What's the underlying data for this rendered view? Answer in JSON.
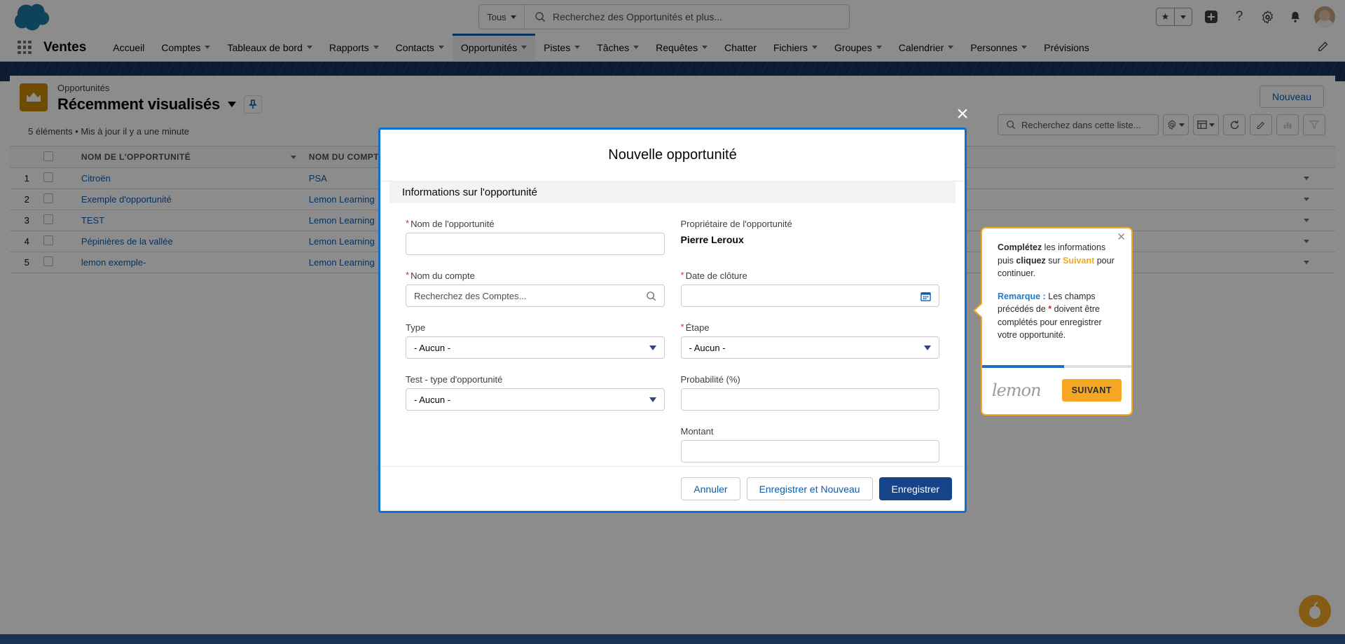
{
  "header": {
    "logo": "salesforce-cloud-logo",
    "search": {
      "scope": "Tous",
      "placeholder": "Recherchez des Opportunités et plus...",
      "value": ""
    },
    "icons": [
      "favorites-star",
      "favorites-caret",
      "quick-add",
      "help",
      "setup-gear",
      "notifications",
      "user-avatar"
    ]
  },
  "nav": {
    "app_name": "Ventes",
    "items": [
      {
        "label": "Accueil",
        "has_menu": false,
        "active": false
      },
      {
        "label": "Comptes",
        "has_menu": true,
        "active": false
      },
      {
        "label": "Tableaux de bord",
        "has_menu": true,
        "active": false
      },
      {
        "label": "Rapports",
        "has_menu": true,
        "active": false
      },
      {
        "label": "Contacts",
        "has_menu": true,
        "active": false
      },
      {
        "label": "Opportunités",
        "has_menu": true,
        "active": true
      },
      {
        "label": "Pistes",
        "has_menu": true,
        "active": false
      },
      {
        "label": "Tâches",
        "has_menu": true,
        "active": false
      },
      {
        "label": "Requêtes",
        "has_menu": true,
        "active": false
      },
      {
        "label": "Chatter",
        "has_menu": false,
        "active": false
      },
      {
        "label": "Fichiers",
        "has_menu": true,
        "active": false
      },
      {
        "label": "Groupes",
        "has_menu": true,
        "active": false
      },
      {
        "label": "Calendrier",
        "has_menu": true,
        "active": false
      },
      {
        "label": "Personnes",
        "has_menu": true,
        "active": false
      },
      {
        "label": "Prévisions",
        "has_menu": false,
        "active": false
      }
    ]
  },
  "listview": {
    "eyebrow": "Opportunités",
    "title": "Récemment visualisés",
    "subtitle": "5 éléments • Mis à jour il y a une minute",
    "new_button": "Nouveau",
    "search_placeholder": "Recherchez dans cette liste...",
    "columns": [
      "NOM DE L'OPPORTUNITÉ",
      "NOM DU COMPTE"
    ],
    "rows": [
      {
        "n": "1",
        "name": "Citroën",
        "account": "PSA"
      },
      {
        "n": "2",
        "name": "Exemple d'opportunité",
        "account": "Lemon Learning"
      },
      {
        "n": "3",
        "name": "TEST",
        "account": "Lemon Learning"
      },
      {
        "n": "4",
        "name": "Pépinières de la vallée",
        "account": "Lemon Learning"
      },
      {
        "n": "5",
        "name": "lemon exemple-",
        "account": "Lemon Learning"
      }
    ]
  },
  "modal": {
    "title": "Nouvelle opportunité",
    "section": "Informations sur l'opportunité",
    "fields": {
      "opportunity_name": {
        "label": "Nom de l'opportunité",
        "required": true,
        "value": "",
        "placeholder": ""
      },
      "owner": {
        "label": "Propriétaire de l'opportunité",
        "required": false,
        "value": "Pierre Leroux"
      },
      "account_name": {
        "label": "Nom du compte",
        "required": true,
        "placeholder": "Recherchez des Comptes...",
        "value": ""
      },
      "close_date": {
        "label": "Date de clôture",
        "required": true,
        "value": ""
      },
      "type": {
        "label": "Type",
        "required": false,
        "value": "- Aucun -"
      },
      "stage": {
        "label": "Étape",
        "required": true,
        "value": "- Aucun -"
      },
      "test_type": {
        "label": "Test - type d'opportunité",
        "required": false,
        "value": "- Aucun -"
      },
      "probability": {
        "label": "Probabilité (%)",
        "required": false,
        "value": ""
      },
      "amount": {
        "label": "Montant",
        "required": false,
        "value": ""
      }
    },
    "buttons": {
      "cancel": "Annuler",
      "save_new": "Enregistrer et Nouveau",
      "save": "Enregistrer"
    }
  },
  "coach": {
    "line1_a": "Complétez",
    "line1_b": " les informations puis ",
    "line1_c": "cliquez",
    "line1_d": " sur ",
    "line1_e": "Suivant",
    "line1_f": " pour continuer.",
    "note_label": "Remarque :",
    "note_a": " Les champs précédés de ",
    "note_star": "*",
    "note_b": " doivent être complétés pour enregistrer votre opportunité.",
    "brand": "lemon",
    "next": "SUIVANT",
    "progress_percent": 55
  },
  "colors": {
    "brand_blue": "#0b5cab",
    "modal_border": "#0b6fd4",
    "save_button": "#16448a",
    "coach_orange": "#f5a623",
    "required_red": "#c23934",
    "crown_gold": "#ca8a04",
    "banner_navy": "#16325c"
  }
}
